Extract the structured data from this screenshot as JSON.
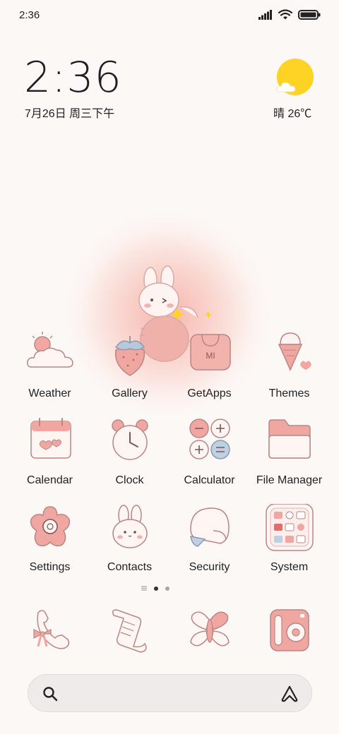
{
  "status_bar": {
    "time": "2:36",
    "icons": [
      "signal-icon",
      "wifi-icon",
      "battery-icon"
    ]
  },
  "clock_widget": {
    "time": "2:36",
    "date": "7月26日 周三下午"
  },
  "weather_widget": {
    "condition_icon": "sunny-cloud-icon",
    "text": "晴 26℃"
  },
  "apps": [
    {
      "label": "Weather",
      "icon": "weather-icon"
    },
    {
      "label": "Gallery",
      "icon": "strawberry-icon"
    },
    {
      "label": "GetApps",
      "icon": "mi-bag-icon"
    },
    {
      "label": "Themes",
      "icon": "ice-cream-icon"
    },
    {
      "label": "Calendar",
      "icon": "calendar-icon"
    },
    {
      "label": "Clock",
      "icon": "alarm-clock-icon"
    },
    {
      "label": "Calculator",
      "icon": "calculator-icon"
    },
    {
      "label": "File Manager",
      "icon": "folder-icon"
    },
    {
      "label": "Settings",
      "icon": "flower-gear-icon"
    },
    {
      "label": "Contacts",
      "icon": "bunny-icon"
    },
    {
      "label": "Security",
      "icon": "helmet-icon"
    },
    {
      "label": "System",
      "icon": "system-folder-icon"
    }
  ],
  "page_indicator": {
    "pages": 2,
    "current": 1
  },
  "dock": [
    "phone-icon",
    "scroll-icon",
    "butterfly-icon",
    "camera-icon"
  ],
  "search_bar": {
    "left_icon": "search-icon",
    "right_icon": "assistant-icon"
  },
  "colors": {
    "background": "#fcf8f6",
    "accent_pink": "#f0a7a2",
    "sun": "#ffd323",
    "outline": "#9a6e6e"
  }
}
